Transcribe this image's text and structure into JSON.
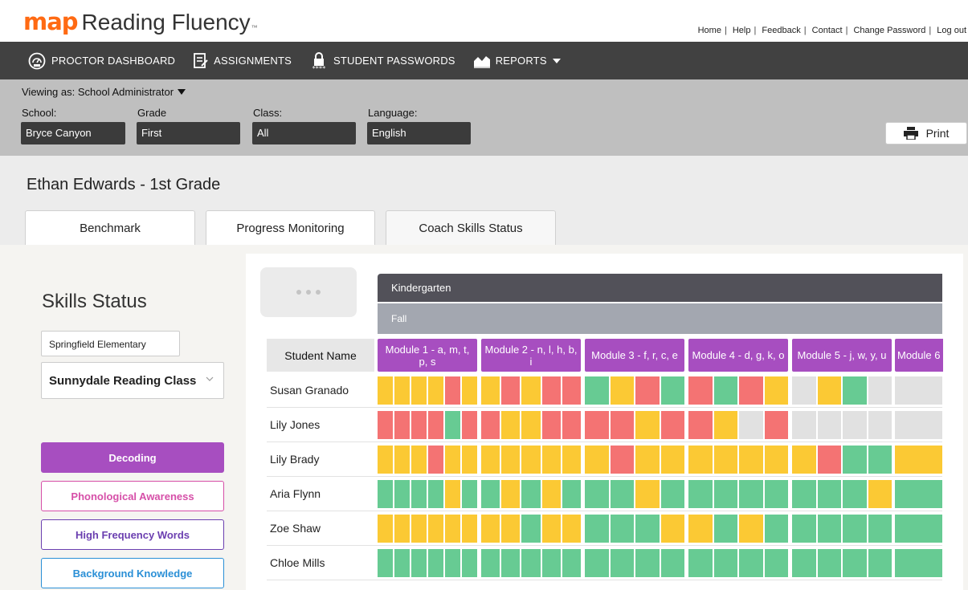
{
  "brand": {
    "logo_mark": "map",
    "product": "Reading Fluency",
    "tm": "™"
  },
  "top_links": [
    "Home",
    "Help",
    "Feedback",
    "Contact",
    "Change Password",
    "Log out"
  ],
  "nav": [
    {
      "label": "PROCTOR DASHBOARD",
      "icon": "speedometer-icon"
    },
    {
      "label": "ASSIGNMENTS",
      "icon": "assignments-icon"
    },
    {
      "label": "STUDENT PASSWORDS",
      "icon": "lock-icon"
    },
    {
      "label": "REPORTS",
      "icon": "reports-icon"
    }
  ],
  "filters": {
    "viewing_as": "Viewing as: School Administrator",
    "school_label": "School:",
    "school_value": "Bryce Canyon",
    "grade_label": "Grade",
    "grade_value": "First",
    "class_label": "Class:",
    "class_value": "All",
    "language_label": "Language:",
    "language_value": "English",
    "print_label": "Print"
  },
  "student": {
    "title": "Ethan Edwards - 1st Grade"
  },
  "tabs": [
    {
      "label": "Benchmark"
    },
    {
      "label": "Progress Monitoring"
    },
    {
      "label": "Coach Skills Status",
      "active": true
    }
  ],
  "left_panel": {
    "title": "Skills Status",
    "school": "Springfield Elementary",
    "class_select": "Sunnydale Reading Class",
    "skills": [
      {
        "label": "Decoding",
        "active": true,
        "color": "#a74ec0"
      },
      {
        "label": "Phonological Awareness",
        "color": "#d64fa8"
      },
      {
        "label": "High Frequency Words",
        "color": "#6b3fb0"
      },
      {
        "label": "Background Knowledge",
        "color": "#2a8fd6"
      }
    ]
  },
  "grid": {
    "grade": "Kindergarten",
    "season": "Fall",
    "student_name_header": "Student Name",
    "modules": [
      "Module 1 - a, m, t, p, s",
      "Module 2 - n, l, h, b, i",
      "Module 3 - f, r, c, e",
      "Module 4 - d, g, k, o",
      "Module 5 - j, w, y, u",
      "Module 6"
    ],
    "status_colors": {
      "Y": "#fbc934",
      "R": "#f47373",
      "G": "#67cb93",
      "E": "#e1e1e1"
    },
    "students": [
      {
        "name": "Susan Granado",
        "cells": "YYYYRY YRYRR GYRG RGRY EYGE EE"
      },
      {
        "name": "Lily Jones",
        "cells": "RRRRGR RYYRR RRYR RYER EEEE EE"
      },
      {
        "name": "Lily Brady",
        "cells": "YYYRYY YYYYY YRYY YYYY YRGG YG"
      },
      {
        "name": "Aria Flynn",
        "cells": "GGGGYG GYGYG GGYG GGGG GGGY GG"
      },
      {
        "name": "Zoe Shaw",
        "cells": "YYYYYY YYGYY GGGY YGYG GGGG GY"
      },
      {
        "name": "Chloe Mills",
        "cells": "GGGGGG GGGGG GGGG GGGG GGGG GG"
      }
    ]
  }
}
